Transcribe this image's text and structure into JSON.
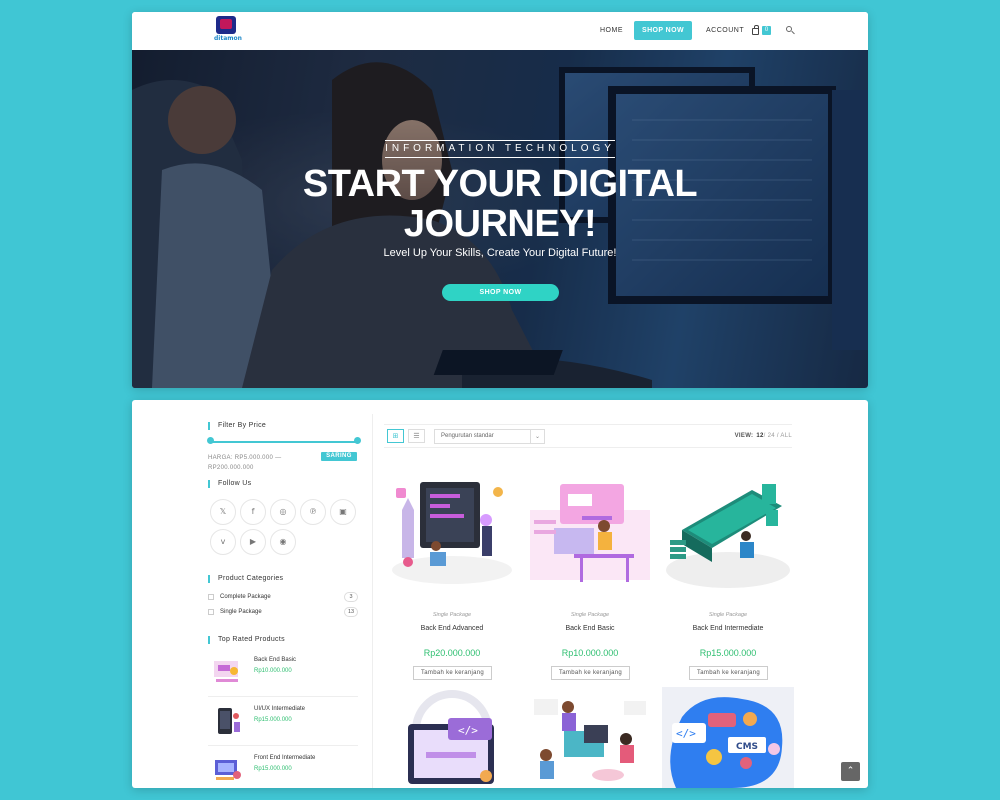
{
  "header": {
    "logo_text": "ditamon",
    "nav": {
      "home": "HOME",
      "shop_now": "SHOP NOW",
      "account": "ACCOUNT"
    },
    "cart_count": "0"
  },
  "hero": {
    "subtitle": "INFORMATION TECHNOLOGY",
    "title": "START YOUR DIGITAL JOURNEY!",
    "tagline": "Level Up Your Skills, Create Your Digital Future!",
    "button": "SHOP NOW"
  },
  "sidebar": {
    "filter_price": {
      "title": "Filter By Price",
      "range_text": "HARGA: RP5.000.000 — RP200.000.000",
      "button": "SARING",
      "range_fraction": [
        0.0,
        1.0
      ]
    },
    "follow_us": {
      "title": "Follow Us",
      "icons": [
        "x-icon",
        "facebook-icon",
        "instagram-icon",
        "pinterest-icon",
        "discord-icon",
        "vine-icon",
        "youtube-icon",
        "rss-icon"
      ]
    },
    "categories": {
      "title": "Product Categories",
      "items": [
        {
          "name": "Complete Package",
          "count": "3"
        },
        {
          "name": "Single Package",
          "count": "13"
        }
      ]
    },
    "top_rated": {
      "title": "Top Rated Products",
      "items": [
        {
          "name": "Back End Basic",
          "price": "Rp10.000.000"
        },
        {
          "name": "UI/UX Intermediate",
          "price": "Rp15.000.000"
        },
        {
          "name": "Front End Intermediate",
          "price": "Rp15.000.000"
        }
      ]
    }
  },
  "toolbar": {
    "sort": "Pengurutan standar",
    "view_label": "VIEW:",
    "view_current": "12",
    "view_options": "/ 24 / ALL"
  },
  "products": [
    {
      "category": "Single Package",
      "name": "Back End Advanced",
      "price": "Rp20.000.000",
      "button": "Tambah ke keranjang"
    },
    {
      "category": "Single Package",
      "name": "Back End Basic",
      "price": "Rp10.000.000",
      "button": "Tambah ke keranjang"
    },
    {
      "category": "Single Package",
      "name": "Back End Intermediate",
      "price": "Rp15.000.000",
      "button": "Tambah ke keranjang"
    }
  ],
  "colors": {
    "accent": "#43c7d3",
    "hero_button": "#2fd3c5",
    "price_green": "#2fbf71",
    "background": "#40c6d4"
  }
}
